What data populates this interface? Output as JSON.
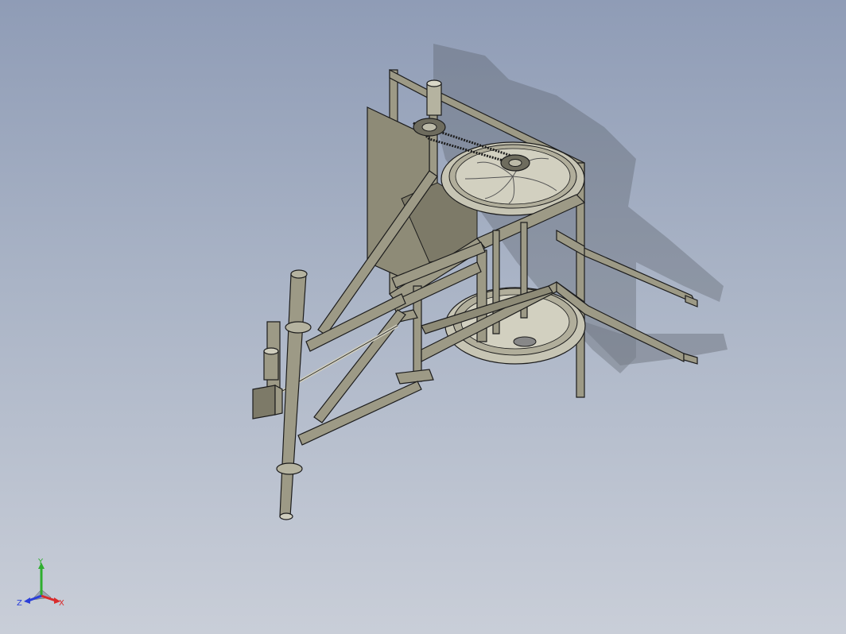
{
  "viewport": {
    "background_top": "#8f9cb6",
    "background_bottom": "#c9ced8"
  },
  "model": {
    "part_color": "#9d9a86",
    "edge_color": "#1c1c1c",
    "shadow_color": "#4b5058"
  },
  "triad": {
    "x_label": "X",
    "y_label": "Y",
    "z_label": "Z",
    "x_color": "#d92b2b",
    "y_color": "#2fae2f",
    "z_color": "#2b3fd9"
  }
}
